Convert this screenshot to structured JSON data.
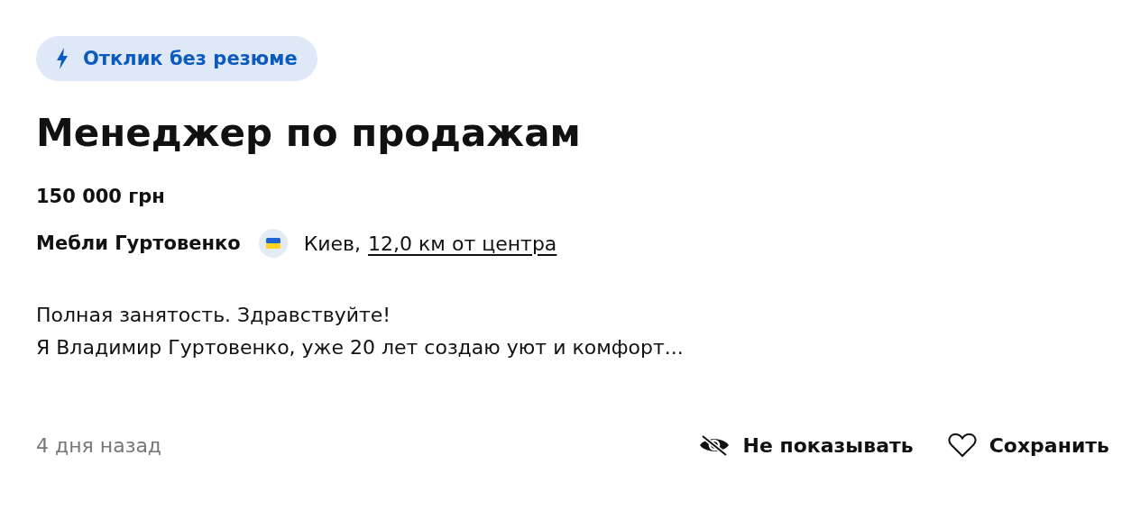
{
  "badge": {
    "label": "Отклик без резюме"
  },
  "title": "Менеджер по продажам",
  "salary": "150 000 грн",
  "company": "Мебли Гуртовенко",
  "location": {
    "city": "Киев,",
    "distance": "12,0 км от центра"
  },
  "description": [
    "Полная занятость. Здравствуйте!",
    "Я Владимир Гуртовенко, уже 20 лет создаю уют и комфорт..."
  ],
  "posted": "4 дня назад",
  "actions": [
    {
      "kind": "hide",
      "label": "Не показывать"
    },
    {
      "kind": "save",
      "label": "Сохранить"
    }
  ]
}
